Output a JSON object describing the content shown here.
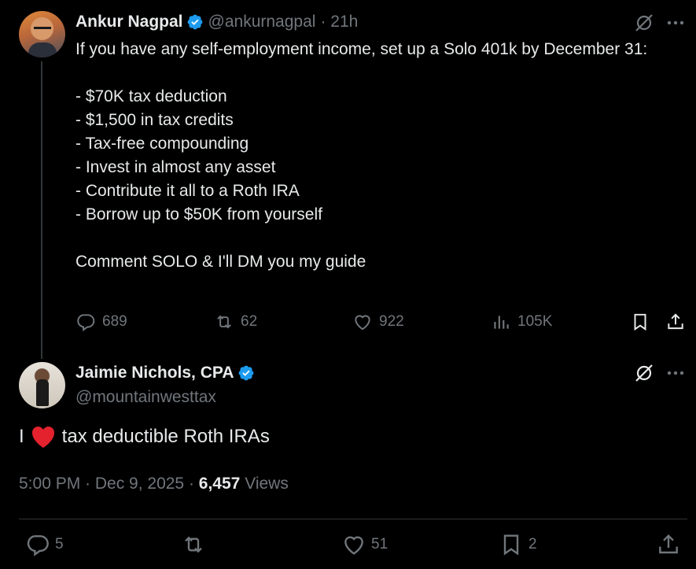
{
  "thread": {
    "original": {
      "name": "Ankur Nagpal",
      "handle": "@ankurnagpal",
      "time": "· 21h",
      "text": "If you have any self-employment income, set up a Solo 401k by December 31:\n\n- $70K tax deduction\n- $1,500 in tax credits\n- Tax-free compounding\n- Invest in almost any asset\n- Contribute it all to a Roth IRA\n- Borrow up to $50K from yourself\n\nComment SOLO & I'll DM you my guide",
      "replies": "689",
      "reposts": "62",
      "likes": "922",
      "views": "105K"
    },
    "reply": {
      "name": "Jaimie Nichols, CPA",
      "handle": "@mountainwesttax",
      "text_before": "I",
      "text_after": "tax deductible Roth IRAs",
      "timestamp": "5:00 PM · Dec 9, 2025 ·",
      "view_count": "6,457",
      "views_label": "Views",
      "replies": "5",
      "likes": "51",
      "bookmarks": "2"
    }
  },
  "colors": {
    "background": "#000000",
    "text": "#e7e9ea",
    "muted": "#71767b",
    "verified": "#1d9bf0",
    "heart": "#f91880"
  }
}
